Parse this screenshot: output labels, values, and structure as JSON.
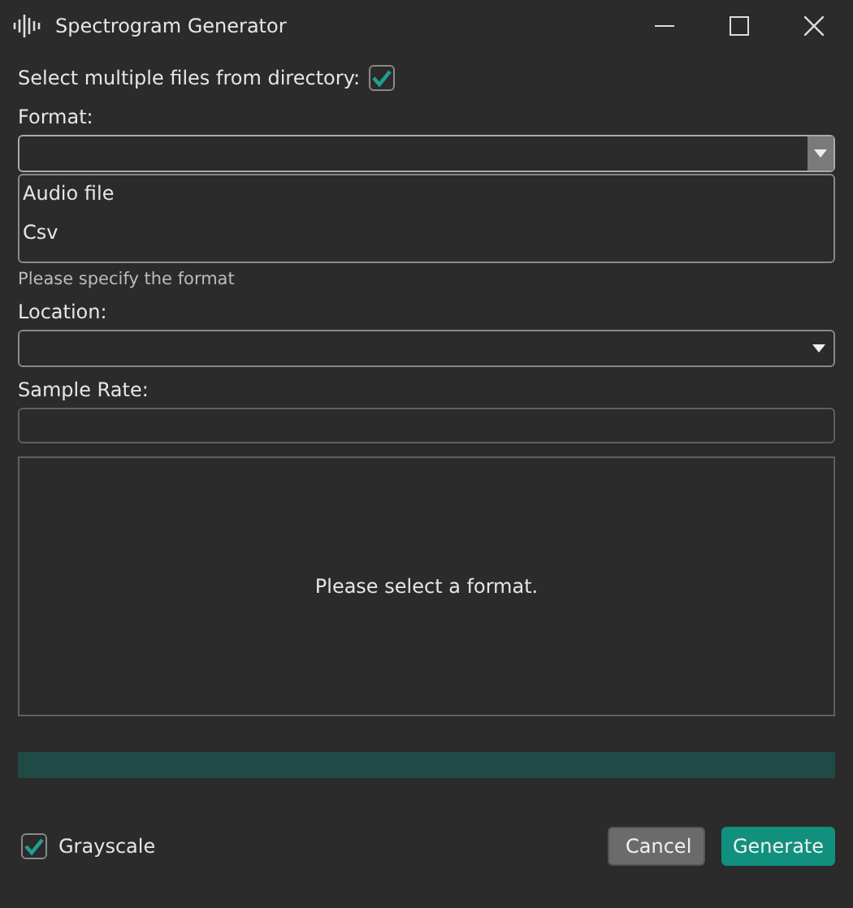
{
  "window": {
    "title": "Spectrogram Generator"
  },
  "multiple_files": {
    "label": "Select multiple files from directory:",
    "checked": true
  },
  "format": {
    "label": "Format:",
    "expanded": true,
    "options": [
      {
        "label": "Audio file",
        "selected": false
      },
      {
        "label": "Csv",
        "selected": false
      }
    ],
    "hint": "Please specify the format"
  },
  "location": {
    "label": "Location:"
  },
  "sample_rate": {
    "label": "Sample Rate:"
  },
  "preview": {
    "message": "Please select a format."
  },
  "progress": {
    "level": 0
  },
  "grayscale": {
    "label": "Grayscale",
    "checked": true
  },
  "buttons": [
    {
      "label": "Cancel",
      "kind": "secondary"
    },
    {
      "label": "Generate",
      "kind": "primary"
    }
  ]
}
